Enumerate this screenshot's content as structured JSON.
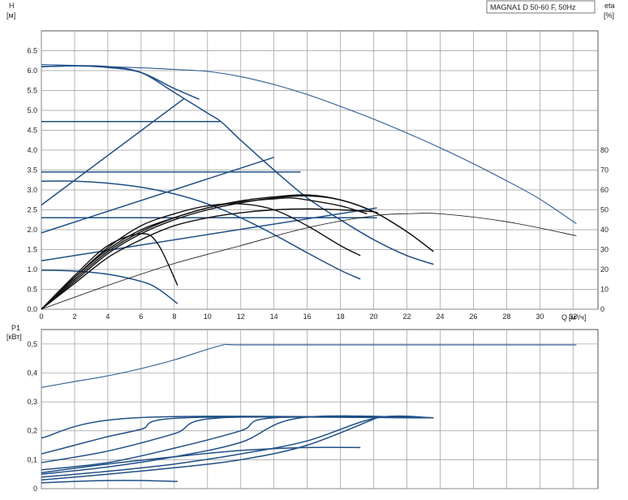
{
  "chart_data": [
    {
      "type": "line",
      "title": "MAGNA1 D 50-60 F, 50Hz",
      "ylabel": "H",
      "yunit": "[м]",
      "y2label": "eta",
      "y2unit": "[%]",
      "xlabel": "Q",
      "xunit": "[м³/ч]",
      "xlim": [
        0,
        33.5
      ],
      "ylim": [
        0,
        7.0
      ],
      "y2lim": [
        0,
        140
      ],
      "grid": true,
      "xticks": [
        "0",
        "2",
        "4",
        "6",
        "8",
        "10",
        "12",
        "14",
        "16",
        "18",
        "20",
        "22",
        "24",
        "26",
        "28",
        "30",
        "32"
      ],
      "yticks": [
        "0.0",
        "0.5",
        "1.0",
        "1.5",
        "2.0",
        "2.5",
        "3.0",
        "3.5",
        "4.0",
        "4.5",
        "5.0",
        "5.5",
        "6.0",
        "6.5"
      ],
      "y2ticks": [
        "0",
        "10",
        "20",
        "30",
        "40",
        "50",
        "60",
        "70",
        "80"
      ],
      "series": [
        {
          "role": "head",
          "x": [
            0,
            2,
            4,
            6,
            8,
            10,
            12,
            14,
            16,
            18,
            20,
            22,
            24,
            26,
            28,
            30,
            32.2
          ],
          "y": [
            6.15,
            6.13,
            6.1,
            6.07,
            6.03,
            5.98,
            5.85,
            5.65,
            5.4,
            5.1,
            4.78,
            4.43,
            4.06,
            3.66,
            3.23,
            2.77,
            2.15
          ]
        },
        {
          "role": "head",
          "x": [
            0,
            2,
            4,
            6,
            8,
            10,
            10.8,
            12,
            14,
            16,
            18,
            20,
            22,
            23.6
          ],
          "y": [
            6.1,
            6.12,
            6.1,
            5.95,
            5.45,
            4.93,
            4.72,
            4.25,
            3.5,
            2.8,
            2.25,
            1.75,
            1.35,
            1.13
          ]
        },
        {
          "role": "head",
          "x": [
            0,
            2,
            4,
            6,
            8,
            9.5
          ],
          "y": [
            6.1,
            6.12,
            6.08,
            5.95,
            5.55,
            5.28
          ]
        },
        {
          "role": "head",
          "x": [
            0,
            10.8
          ],
          "y": [
            4.72,
            4.72
          ]
        },
        {
          "role": "head",
          "x": [
            0,
            15.6
          ],
          "y": [
            3.45,
            3.45
          ]
        },
        {
          "role": "head",
          "x": [
            0,
            20.2
          ],
          "y": [
            2.3,
            2.3
          ]
        },
        {
          "role": "head",
          "x": [
            0,
            8.6
          ],
          "y": [
            2.62,
            5.3
          ]
        },
        {
          "role": "head",
          "x": [
            0,
            14
          ],
          "y": [
            1.92,
            3.82
          ]
        },
        {
          "role": "head",
          "x": [
            0,
            20.2
          ],
          "y": [
            1.22,
            2.55
          ]
        },
        {
          "role": "head",
          "x": [
            0,
            2,
            4,
            6,
            8,
            10,
            12,
            14,
            16,
            18,
            19.2
          ],
          "y": [
            3.22,
            3.22,
            3.17,
            3.07,
            2.9,
            2.65,
            2.3,
            1.88,
            1.42,
            0.98,
            0.76
          ]
        },
        {
          "role": "head",
          "x": [
            0,
            2,
            4,
            6,
            7,
            8.2
          ],
          "y": [
            0.98,
            0.96,
            0.88,
            0.7,
            0.52,
            0.14
          ]
        },
        {
          "role": "eta",
          "x": [
            0,
            2,
            4,
            6,
            8,
            10,
            12,
            14,
            15,
            16,
            18,
            19.6
          ],
          "y": [
            0,
            16,
            30,
            40,
            46,
            51,
            54,
            55.5,
            56,
            55,
            52,
            48
          ]
        },
        {
          "role": "eta",
          "x": [
            0,
            2,
            4,
            6,
            8,
            10,
            12,
            14,
            16,
            18,
            20,
            22,
            23.6
          ],
          "y": [
            0,
            15,
            29,
            39,
            46,
            51,
            54.5,
            56.5,
            57.5,
            55,
            49,
            39,
            29
          ]
        },
        {
          "role": "eta",
          "x": [
            0,
            2,
            4,
            6,
            8,
            10,
            12,
            14,
            16,
            18,
            20,
            22,
            23.6
          ],
          "y": [
            0,
            14,
            28,
            38,
            45,
            50,
            53.5,
            56,
            57,
            55,
            49,
            39,
            29
          ]
        },
        {
          "role": "eta",
          "x": [
            0,
            2,
            4,
            6,
            8,
            10,
            12,
            14,
            16,
            18,
            19.2
          ],
          "y": [
            0,
            16,
            31,
            42,
            48,
            52,
            53,
            50,
            42,
            32,
            27
          ]
        },
        {
          "role": "eta",
          "x": [
            0,
            2,
            4,
            6,
            8,
            10,
            12,
            14,
            16,
            18,
            20,
            20.2
          ],
          "y": [
            0,
            13,
            26,
            35,
            42,
            46,
            48.5,
            50,
            50.5,
            50,
            49,
            48
          ]
        },
        {
          "role": "eta",
          "x": [
            0,
            2,
            4,
            6,
            7,
            8.2
          ],
          "y": [
            0,
            17,
            32,
            38,
            33,
            12
          ]
        },
        {
          "role": "eta",
          "x": [
            0,
            4,
            8,
            12,
            16,
            20,
            22,
            24,
            28,
            32.2
          ],
          "y": [
            0,
            12,
            23,
            32,
            41,
            47,
            48,
            48,
            44,
            37
          ]
        }
      ]
    },
    {
      "type": "line",
      "ylabel": "P1",
      "yunit": "[кВт]",
      "xlim": [
        0,
        33.5
      ],
      "ylim": [
        0,
        0.55
      ],
      "grid": true,
      "yticks": [
        "0",
        "0,1",
        "0,2",
        "0,3",
        "0,4",
        "0,5"
      ],
      "series": [
        {
          "role": "power",
          "x": [
            0,
            2,
            4,
            6,
            8,
            10.8,
            12,
            20,
            32.2
          ],
          "y": [
            0.35,
            0.37,
            0.39,
            0.415,
            0.445,
            0.495,
            0.497,
            0.497,
            0.497
          ]
        },
        {
          "role": "power",
          "x": [
            0,
            5.7,
            23.6
          ],
          "y": [
            0.175,
            0.245,
            0.245
          ]
        },
        {
          "role": "power",
          "x": [
            0,
            2,
            4,
            6,
            8.6,
            23.6
          ],
          "y": [
            0.12,
            0.15,
            0.18,
            0.205,
            0.245,
            0.245
          ]
        },
        {
          "role": "power",
          "x": [
            0,
            4,
            8,
            10.8,
            23.6
          ],
          "y": [
            0.09,
            0.13,
            0.19,
            0.245,
            0.245
          ]
        },
        {
          "role": "power",
          "x": [
            0,
            4,
            8,
            12,
            14,
            23.6
          ],
          "y": [
            0.065,
            0.09,
            0.14,
            0.2,
            0.245,
            0.245
          ]
        },
        {
          "role": "power",
          "x": [
            0,
            4,
            8,
            12,
            15.6,
            23.6
          ],
          "y": [
            0.05,
            0.075,
            0.11,
            0.16,
            0.245,
            0.245
          ]
        },
        {
          "role": "power",
          "x": [
            0,
            4,
            8,
            12,
            16,
            20.2,
            23.6
          ],
          "y": [
            0.04,
            0.06,
            0.085,
            0.12,
            0.165,
            0.245,
            0.245
          ]
        },
        {
          "role": "power",
          "x": [
            0,
            4,
            8,
            12,
            16,
            20.2
          ],
          "y": [
            0.03,
            0.05,
            0.072,
            0.1,
            0.15,
            0.245
          ]
        },
        {
          "role": "power",
          "x": [
            0,
            4,
            8,
            12,
            16,
            19.2
          ],
          "y": [
            0.055,
            0.085,
            0.11,
            0.132,
            0.142,
            0.142
          ]
        },
        {
          "role": "power",
          "x": [
            0,
            2,
            4,
            6,
            8.2
          ],
          "y": [
            0.02,
            0.025,
            0.028,
            0.028,
            0.025
          ]
        }
      ]
    }
  ]
}
